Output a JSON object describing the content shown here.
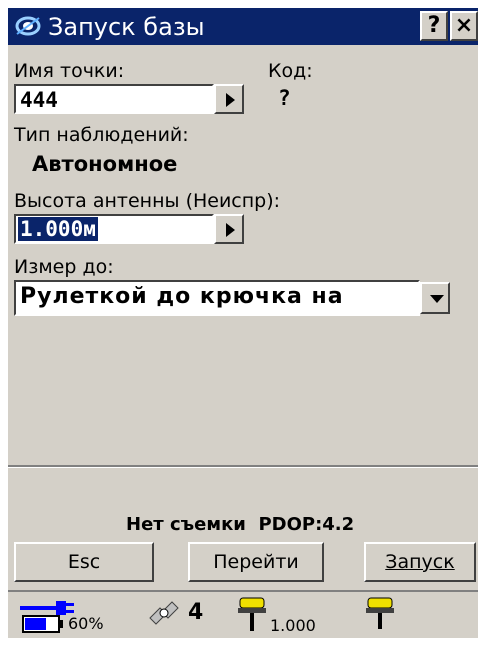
{
  "window": {
    "title": "Запуск базы",
    "help_label": "?",
    "close_label": "×"
  },
  "point": {
    "name_label": "Имя точки:",
    "name_value": "444",
    "code_label": "Код:",
    "code_value": "?"
  },
  "observation": {
    "type_label": "Тип наблюдений:",
    "type_value": "Автономное"
  },
  "antenna": {
    "height_label": "Высота антенны (Неиспр):",
    "height_value": "1.000м"
  },
  "measure": {
    "label": "Измер до:",
    "value": "Рулеткой до крючка на"
  },
  "status": {
    "message": "Нет съемки  PDOP:4.2"
  },
  "buttons": {
    "esc": "Esc",
    "goto": "Перейти",
    "start": "Запуск"
  },
  "statusbar": {
    "battery_percent": "60%",
    "satellites": "4",
    "antenna_height": "1.000"
  },
  "colors": {
    "titlebar": "#0a246a",
    "face": "#d4d0c8",
    "selection": "#0a246a",
    "power_blue": "#0000ff",
    "receiver_yellow": "#f0e000"
  }
}
